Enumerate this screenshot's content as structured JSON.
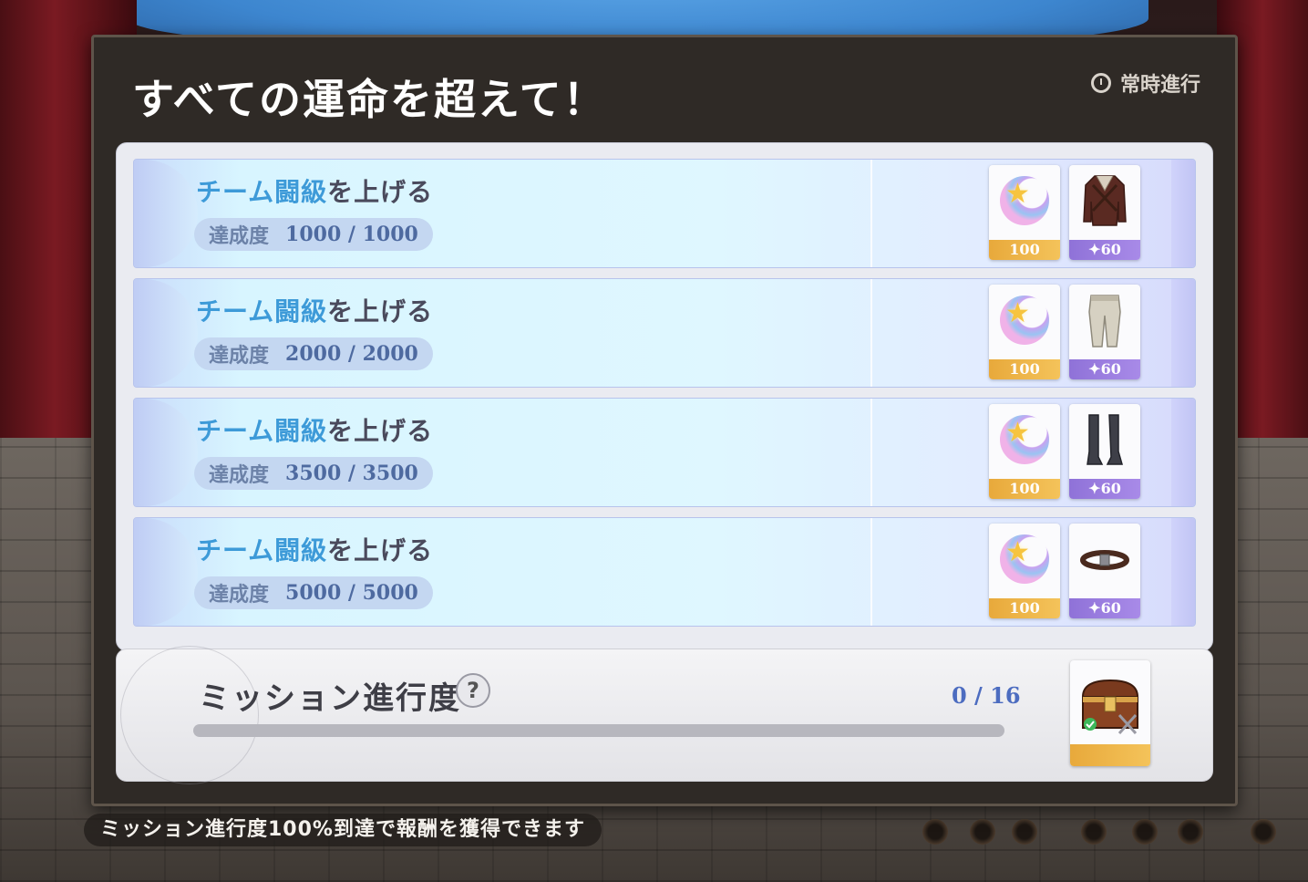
{
  "panel": {
    "title": "すべての運命を超えて！",
    "mode_label": "常時進行"
  },
  "missions": [
    {
      "title_highlight": "チーム闘級",
      "title_rest": "を上げる",
      "progress_label": "達成度",
      "progress_value": "1000 / 1000",
      "reward_gem_count": "100",
      "reward_item_icon": "coat-icon",
      "reward_item_count": "✦60"
    },
    {
      "title_highlight": "チーム闘級",
      "title_rest": "を上げる",
      "progress_label": "達成度",
      "progress_value": "2000 / 2000",
      "reward_gem_count": "100",
      "reward_item_icon": "pants-icon",
      "reward_item_count": "✦60"
    },
    {
      "title_highlight": "チーム闘級",
      "title_rest": "を上げる",
      "progress_label": "達成度",
      "progress_value": "3500 / 3500",
      "reward_gem_count": "100",
      "reward_item_icon": "boots-icon",
      "reward_item_count": "✦60"
    },
    {
      "title_highlight": "チーム闘級",
      "title_rest": "を上げる",
      "progress_label": "達成度",
      "progress_value": "5000 / 5000",
      "reward_gem_count": "100",
      "reward_item_icon": "belt-icon",
      "reward_item_count": "✦60"
    }
  ],
  "mission_progress": {
    "label": "ミッション進行度",
    "help_symbol": "?",
    "count": "0 / 16",
    "fraction": 0,
    "reward_icon": "treasure-chest-icon"
  },
  "footer_note": "ミッション進行度100%到達で報酬を獲得できます",
  "colors": {
    "title_highlight": "#3d9ad8",
    "gold_strip": "#f0b84a",
    "purple_strip": "#9a7fe0",
    "progress_count": "#4c6cc0"
  }
}
